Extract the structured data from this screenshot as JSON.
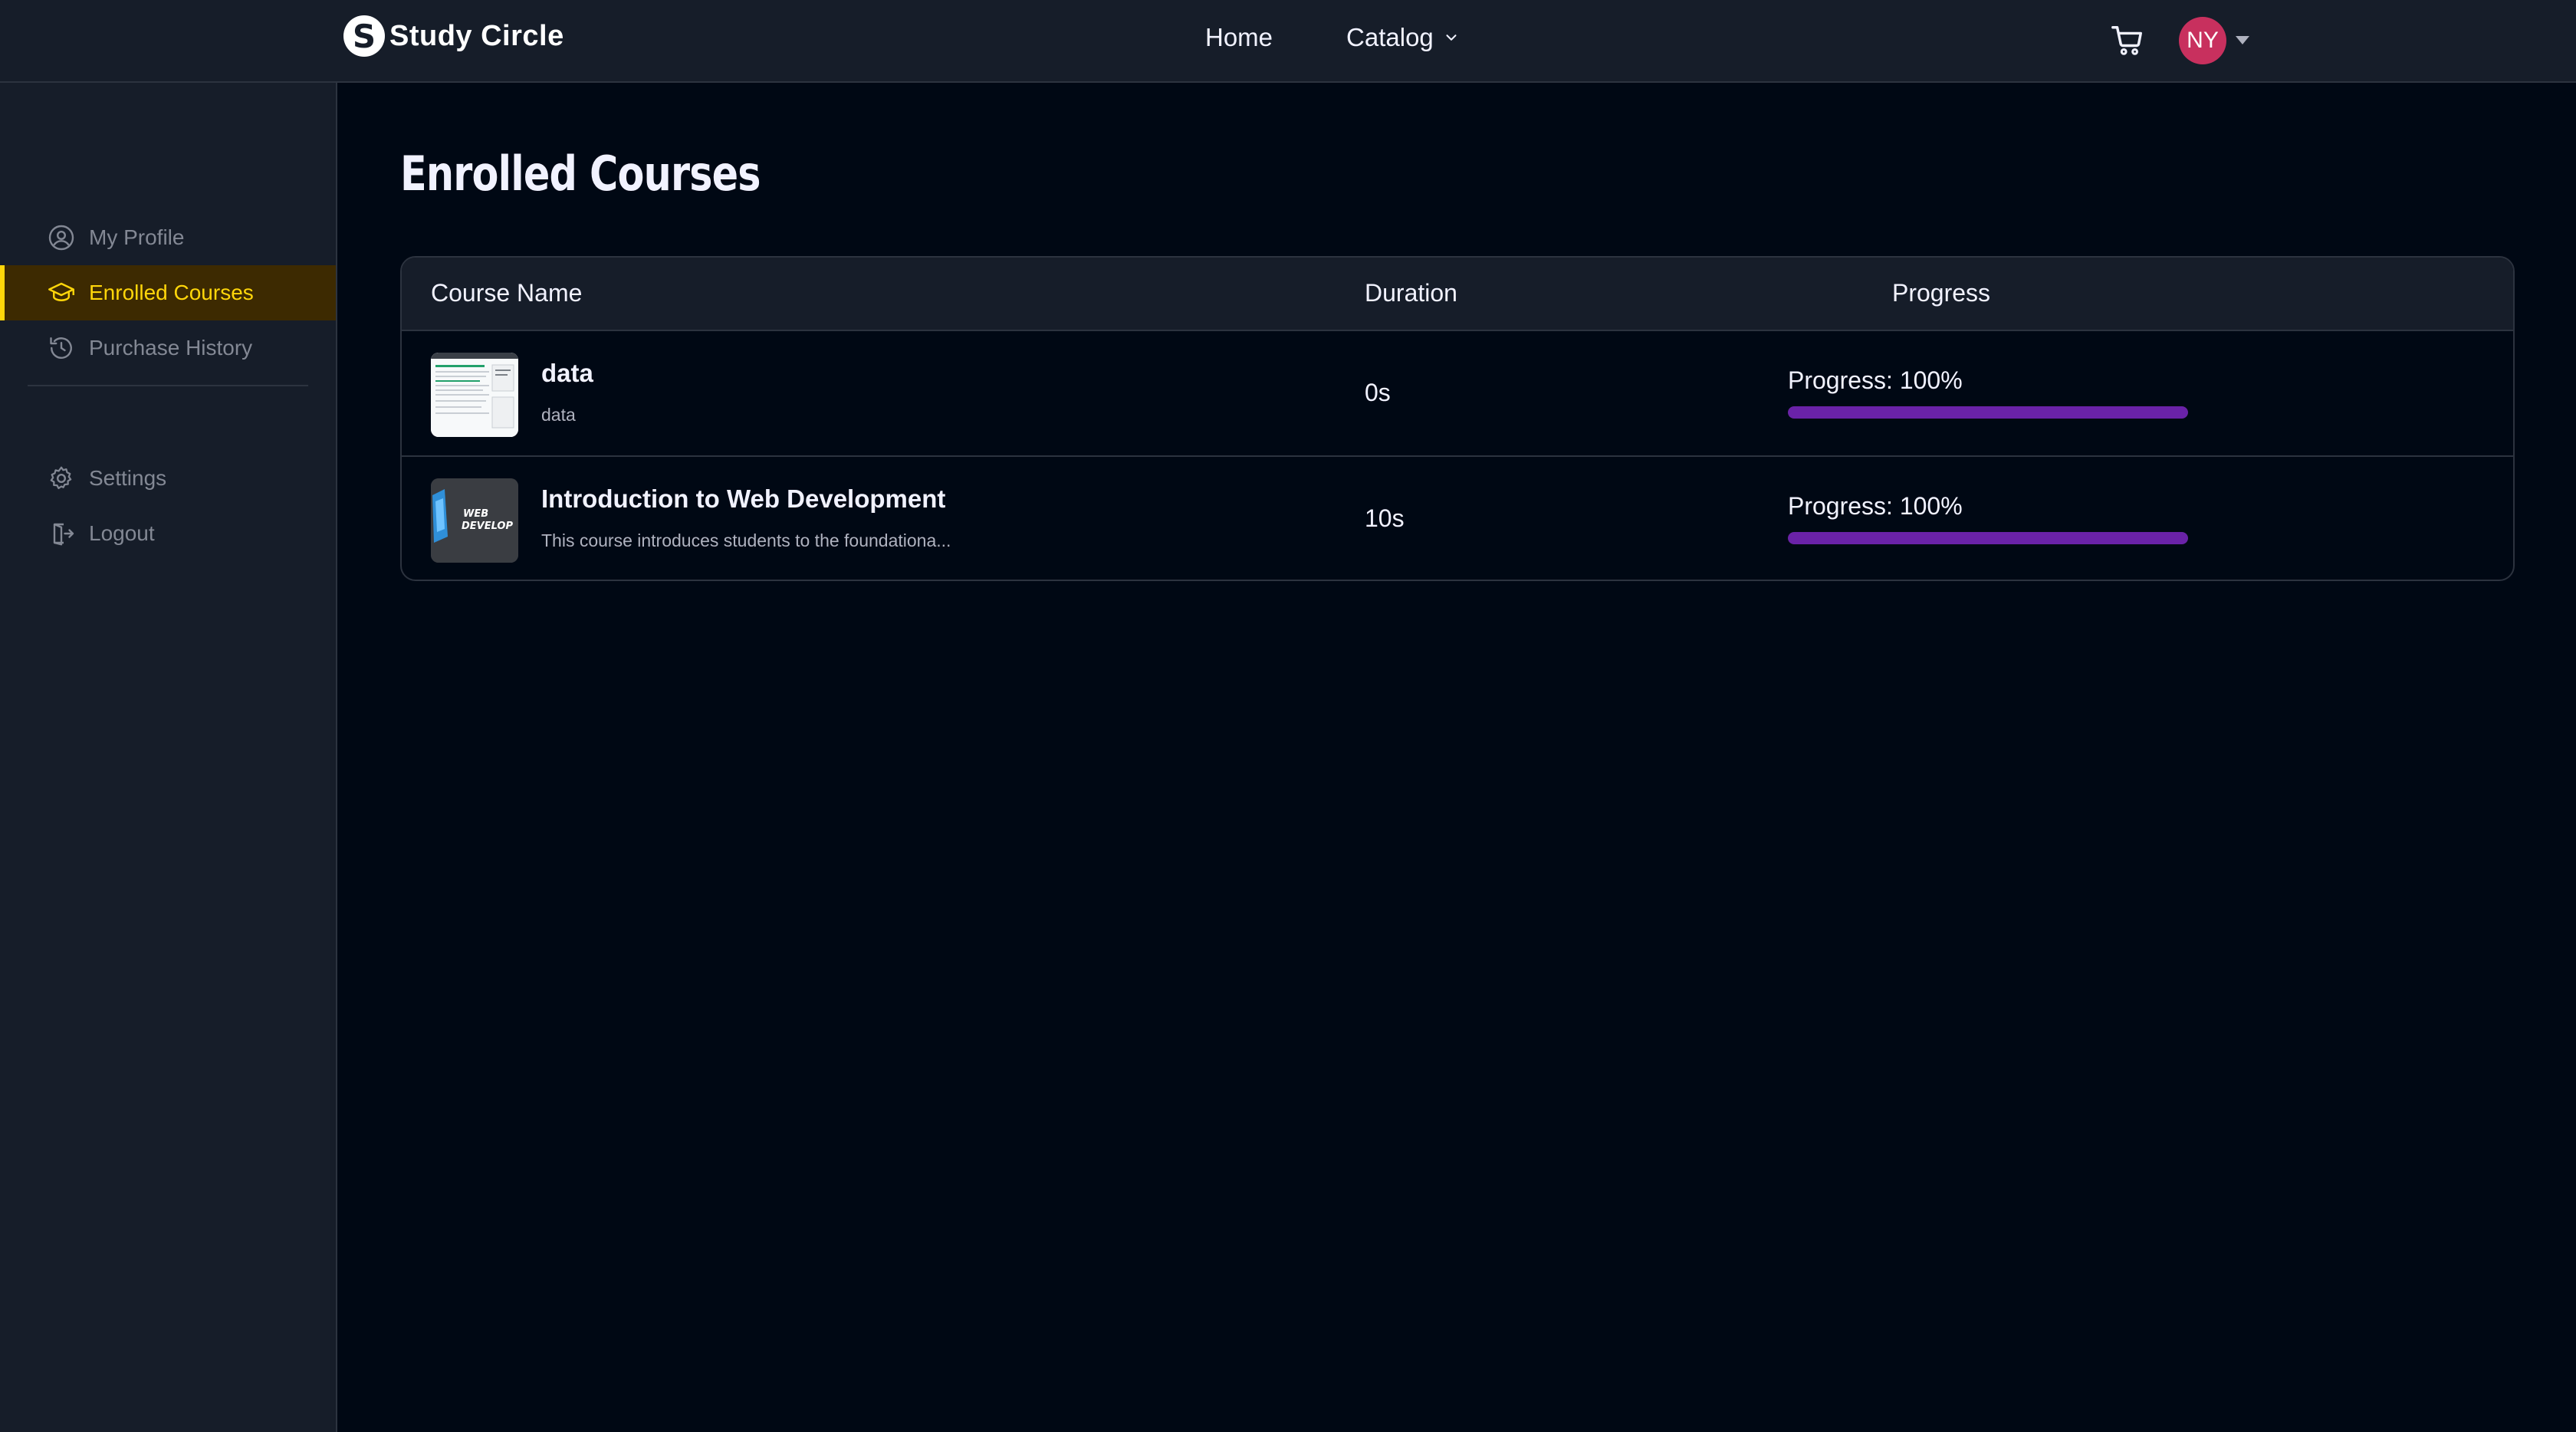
{
  "brand": {
    "logo_letter": "S",
    "name": "Study Circle"
  },
  "nav": {
    "home_label": "Home",
    "catalog_label": "Catalog",
    "avatar_initials": "NY"
  },
  "sidebar": {
    "items": [
      {
        "label": "My Profile",
        "icon": "user-circle-icon"
      },
      {
        "label": "Enrolled Courses",
        "icon": "graduation-cap-icon",
        "active": true
      },
      {
        "label": "Purchase History",
        "icon": "history-icon"
      },
      {
        "label": "Settings",
        "icon": "gear-icon"
      },
      {
        "label": "Logout",
        "icon": "logout-icon"
      }
    ]
  },
  "page": {
    "title": "Enrolled Courses"
  },
  "table": {
    "headers": {
      "course": "Course Name",
      "duration": "Duration",
      "progress": "Progress"
    },
    "rows": [
      {
        "name": "data",
        "description": "data",
        "duration": "0s",
        "progress_text": "Progress: 100%",
        "progress": 100,
        "thumbnail": "document-thumbnail"
      },
      {
        "name": "Introduction to Web Development",
        "description": "This course introduces students to the foundationa...",
        "duration": "10s",
        "progress_text": "Progress: 100%",
        "progress": 100,
        "thumbnail": "web-development-thumbnail",
        "thumbnail_text": "WEB DEVELOP"
      }
    ]
  },
  "colors": {
    "accent_yellow": "#ffd60a",
    "progress_purple": "#6a22a8",
    "avatar_pink": "#c8305e"
  }
}
